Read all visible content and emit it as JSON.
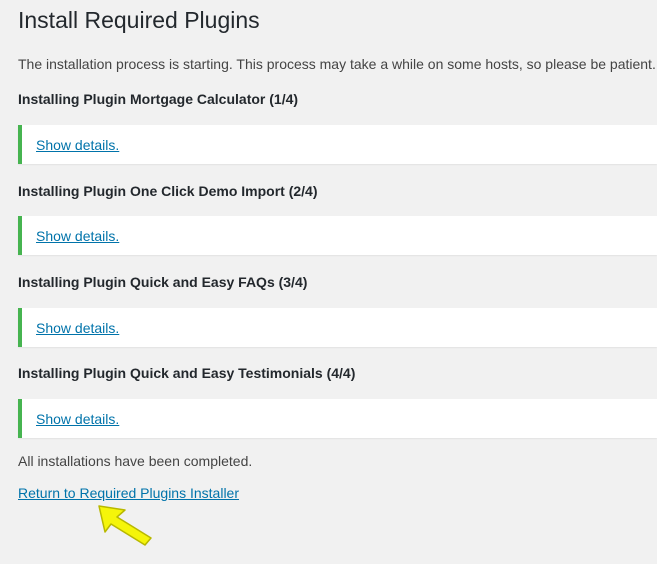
{
  "page": {
    "title": "Install Required Plugins",
    "intro": "The installation process is starting. This process may take a while on some hosts, so please be patient."
  },
  "plugins": [
    {
      "heading": "Installing Plugin Mortgage Calculator (1/4)",
      "details_link": "Show details."
    },
    {
      "heading": "Installing Plugin One Click Demo Import (2/4)",
      "details_link": "Show details."
    },
    {
      "heading": "Installing Plugin Quick and Easy FAQs (3/4)",
      "details_link": "Show details."
    },
    {
      "heading": "Installing Plugin Quick and Easy Testimonials (4/4)",
      "details_link": "Show details."
    }
  ],
  "footer": {
    "complete_message": "All installations have been completed.",
    "return_link": "Return to Required Plugins Installer"
  },
  "colors": {
    "background": "#f1f1f1",
    "notice_border": "#46b450",
    "link": "#0073aa",
    "highlight_arrow": "#f5f50a"
  },
  "icons": {
    "pointer": "yellow-arrow-icon"
  }
}
